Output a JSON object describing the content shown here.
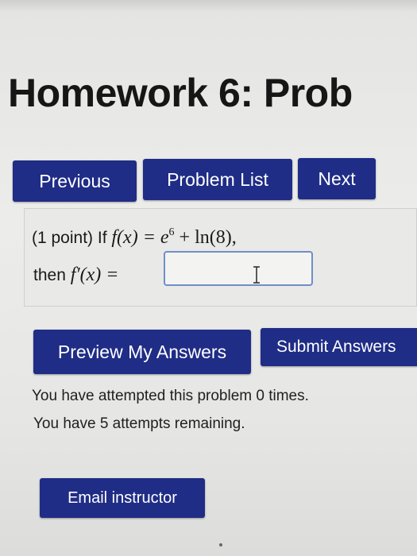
{
  "header": {
    "title": "Homework 6: Prob"
  },
  "nav": {
    "previous_label": "Previous",
    "problem_list_label": "Problem List",
    "next_label": "Next"
  },
  "problem": {
    "intro": "(1 point) If ",
    "function_lhs": "f(x) = e",
    "exponent": "6",
    "function_rhs": " + ln(8),",
    "then_text": "then ",
    "derivative_lhs": "f′(x) =",
    "answer_value": "",
    "answer_placeholder": ""
  },
  "actions": {
    "preview_label": "Preview My Answers",
    "submit_label": "Submit Answers"
  },
  "status": {
    "attempts_made": "You have attempted this problem 0 times.",
    "attempts_remaining": "You have 5 attempts remaining."
  },
  "footer": {
    "email_label": "Email instructor"
  },
  "colors": {
    "button_bg": "#1f2d86",
    "button_text": "#ffffff",
    "input_border": "#6e8fc9"
  }
}
